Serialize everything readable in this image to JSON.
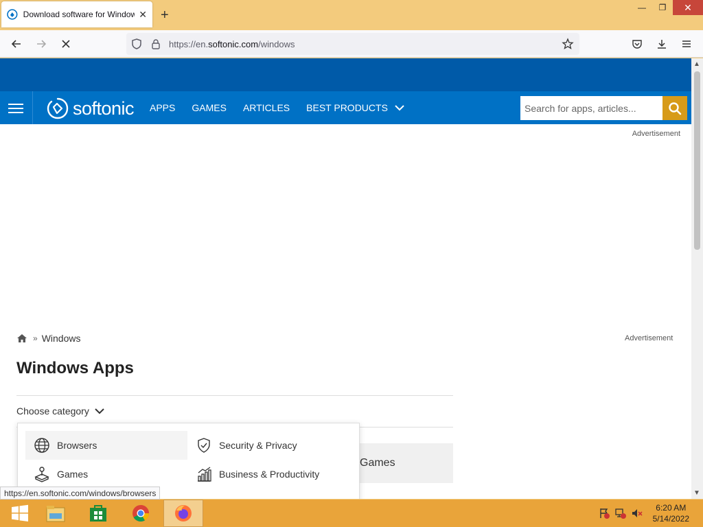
{
  "browser": {
    "tab_title": "Download software for Windows",
    "url_prefix": "https://en.",
    "url_domain": "softonic.com",
    "url_path": "/windows",
    "status_link": "https://en.softonic.com/windows/browsers"
  },
  "site": {
    "logo_text": "softonic",
    "menu": [
      "APPS",
      "GAMES",
      "ARTICLES",
      "BEST PRODUCTS"
    ],
    "search_placeholder": "Search for apps, articles...",
    "advertisement": "Advertisement"
  },
  "content": {
    "breadcrumb_sep": "»",
    "breadcrumb_current": "Windows",
    "title": "Windows Apps",
    "choose_category": "Choose category",
    "bg_card_label": "Games"
  },
  "dropdown": {
    "items": [
      "Browsers",
      "Security & Privacy",
      "Games",
      "Business & Productivity"
    ]
  },
  "taskbar": {
    "time": "6:20 AM",
    "date": "5/14/2022"
  },
  "colors": {
    "brand_blue": "#0071c5",
    "top_band": "#005aa8",
    "search_button": "#d79b19",
    "taskbar": "#e9a43a"
  }
}
